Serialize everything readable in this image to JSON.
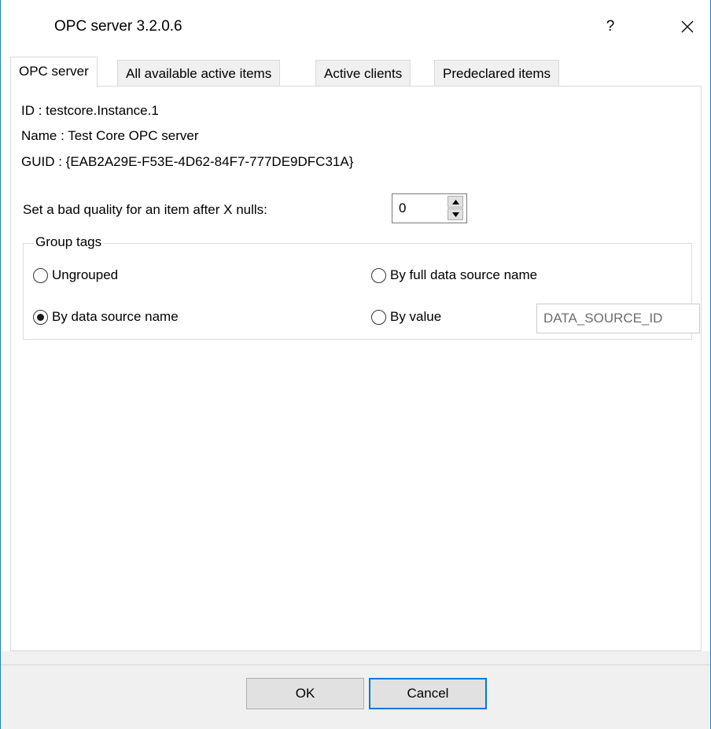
{
  "window": {
    "title": "OPC server 3.2.0.6",
    "help_label": "?",
    "close_icon": "close-icon"
  },
  "tabs": [
    {
      "label": "OPC server",
      "active": true
    },
    {
      "label": "All available active items",
      "active": false
    },
    {
      "label": "Active clients",
      "active": false
    },
    {
      "label": "Predeclared items",
      "active": false
    }
  ],
  "info": {
    "id": "ID : testcore.Instance.1",
    "name": "Name : Test Core OPC server",
    "guid": "GUID : {EAB2A29E-F53E-4D62-84F7-777DE9DFC31A}"
  },
  "nulls": {
    "label": "Set a bad quality for an item after X nulls:",
    "value": "0"
  },
  "group_tags": {
    "title": "Group tags",
    "options": [
      {
        "label": "Ungrouped",
        "checked": false
      },
      {
        "label": "By full data source name",
        "checked": false
      },
      {
        "label": "By data source name",
        "checked": true
      },
      {
        "label": "By value",
        "checked": false
      }
    ],
    "value_field": "DATA_SOURCE_ID"
  },
  "buttons": {
    "ok": "OK",
    "cancel": "Cancel"
  },
  "colors": {
    "accent": "#0078d7",
    "window_border": "#1883d7",
    "footer_bg": "#f0f0f0"
  }
}
